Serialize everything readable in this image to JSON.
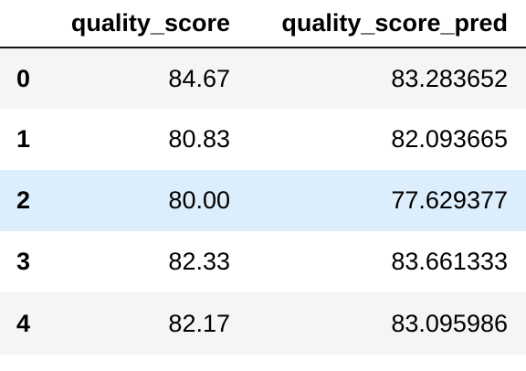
{
  "table": {
    "index_header": "",
    "columns": [
      "quality_score",
      "quality_score_pred"
    ],
    "rows": [
      {
        "index": "0",
        "quality_score": "84.67",
        "quality_score_pred": "83.283652"
      },
      {
        "index": "1",
        "quality_score": "80.83",
        "quality_score_pred": "82.093665"
      },
      {
        "index": "2",
        "quality_score": "80.00",
        "quality_score_pred": "77.629377"
      },
      {
        "index": "3",
        "quality_score": "82.33",
        "quality_score_pred": "83.661333"
      },
      {
        "index": "4",
        "quality_score": "82.17",
        "quality_score_pred": "83.095986"
      }
    ],
    "highlighted_row": 2
  },
  "colors": {
    "striped_row": "#f5f5f5",
    "highlight_row": "#dcedfb",
    "header_rule": "#111111"
  }
}
